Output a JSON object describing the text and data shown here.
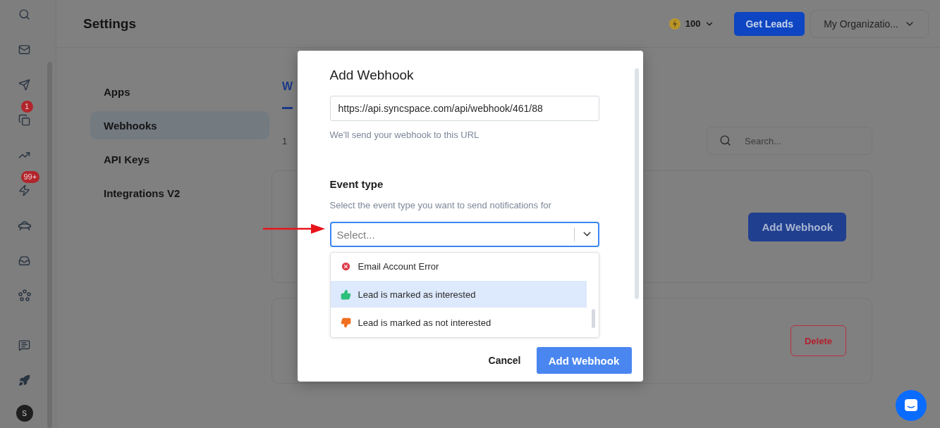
{
  "rail": {
    "badges": [
      "1",
      "99+"
    ],
    "avatar": "S"
  },
  "header": {
    "title": "Settings",
    "credits": "100",
    "get_leads": "Get Leads",
    "organization": "My Organizatio..."
  },
  "settings_nav": {
    "items": [
      {
        "label": "Apps",
        "selected": false
      },
      {
        "label": "Webhooks",
        "selected": true
      },
      {
        "label": "API Keys",
        "selected": false
      },
      {
        "label": "Integrations V2",
        "selected": false
      }
    ]
  },
  "content": {
    "tab": {
      "label": "W",
      "selected": true
    },
    "count": "1",
    "search": {
      "placeholder": "Search..."
    },
    "add_button": "Add Webhook",
    "delete_button": "Delete"
  },
  "modal": {
    "title": "Add Webhook",
    "url": {
      "value": "https://api.syncspace.com/api/webhook/461/88"
    },
    "url_hint": "We'll send your webhook to this URL",
    "event_type_label": "Event type",
    "event_type_hint": "Select the event type you want to send notifications for",
    "select": {
      "placeholder": "Select..."
    },
    "options": [
      {
        "label": "Email Account Error",
        "kind": "error",
        "selected": false
      },
      {
        "label": "Lead is marked as interested",
        "kind": "thumbs-up",
        "selected": true
      },
      {
        "label": "Lead is marked as not interested",
        "kind": "thumbs-down",
        "selected": false
      }
    ],
    "cancel": "Cancel",
    "submit": "Add Webhook"
  }
}
